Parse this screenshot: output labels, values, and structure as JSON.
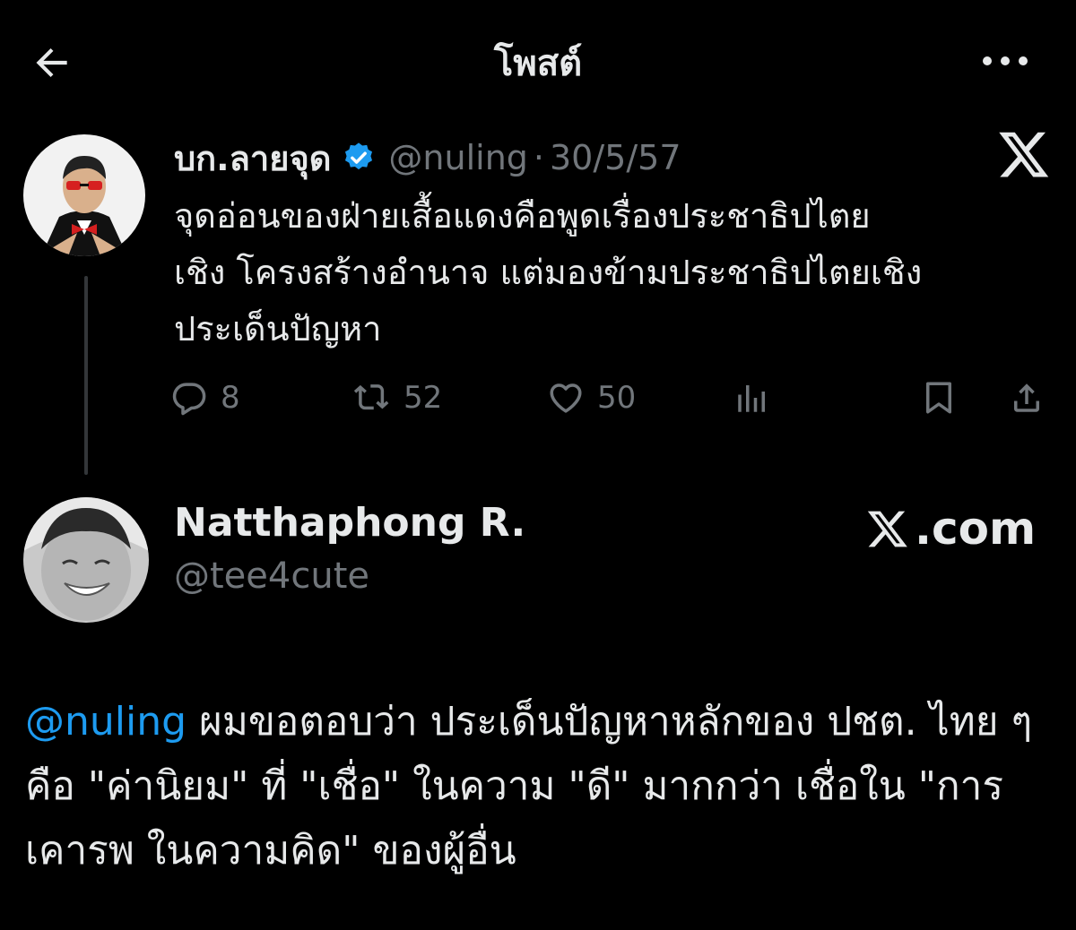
{
  "header": {
    "title": "โพสต์"
  },
  "quoted": {
    "name": "บก.ลายจุด",
    "handle": "@nuling",
    "separator": "·",
    "date": "30/5/57",
    "text": "จุดอ่อนของฝ่ายเสื้อแดงคือพูดเรื่องประชาธิปไตย\nเชิง โครงสร้างอำนาจ แต่มองข้ามประชาธิปไตยเชิง\nประเด็นปัญหา",
    "replies": "8",
    "reposts": "52",
    "likes": "50"
  },
  "reply": {
    "name": "Natthaphong R.",
    "handle": "@tee4cute",
    "brand": ".com",
    "mention": "@nuling",
    "text": " ผมขอตอบว่า ประเด็นปัญหาหลักของ ปชต. ไทย ๆ คือ \"ค่านิยม\" ที่ \"เชื่อ\" ในความ \"ดี\" มากกว่า เชื่อใน \"การเคารพ ในความคิด\" ของผู้อื่น"
  },
  "icons": {
    "back": "arrow-left-icon",
    "more": "more-horizontal-icon",
    "verified": "verified-badge-icon",
    "x_logo": "x-logo-icon",
    "reply": "reply-icon",
    "repost": "repost-icon",
    "like": "heart-icon",
    "views": "analytics-icon",
    "bookmark": "bookmark-icon",
    "share": "share-icon"
  },
  "colors": {
    "background": "#000000",
    "text": "#e7e9ea",
    "muted": "#71767b",
    "accent": "#1d9bf0"
  }
}
